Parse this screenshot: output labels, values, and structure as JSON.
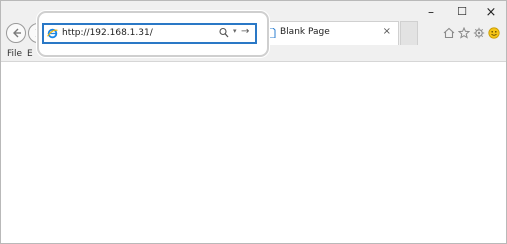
{
  "address_bar": {
    "url": "http://192.168.1.31/",
    "dropdown_glyph": "▾",
    "go_glyph": "→"
  },
  "tab": {
    "title": "Blank Page",
    "close_glyph": "×"
  },
  "window_controls": {
    "minimize": "–",
    "maximize": "☐",
    "close": "×"
  },
  "menu": {
    "file_label": "File",
    "edit_label": "E"
  },
  "icons": {
    "back": "back-icon",
    "forward": "forward-icon",
    "home": "home-icon",
    "favorites": "star-icon",
    "tools": "gear-icon",
    "feedback": "smiley-icon",
    "site": "ie-logo-icon"
  },
  "colors": {
    "address_focus": "#2a78c6",
    "chrome_bg": "#f0f0f0"
  }
}
